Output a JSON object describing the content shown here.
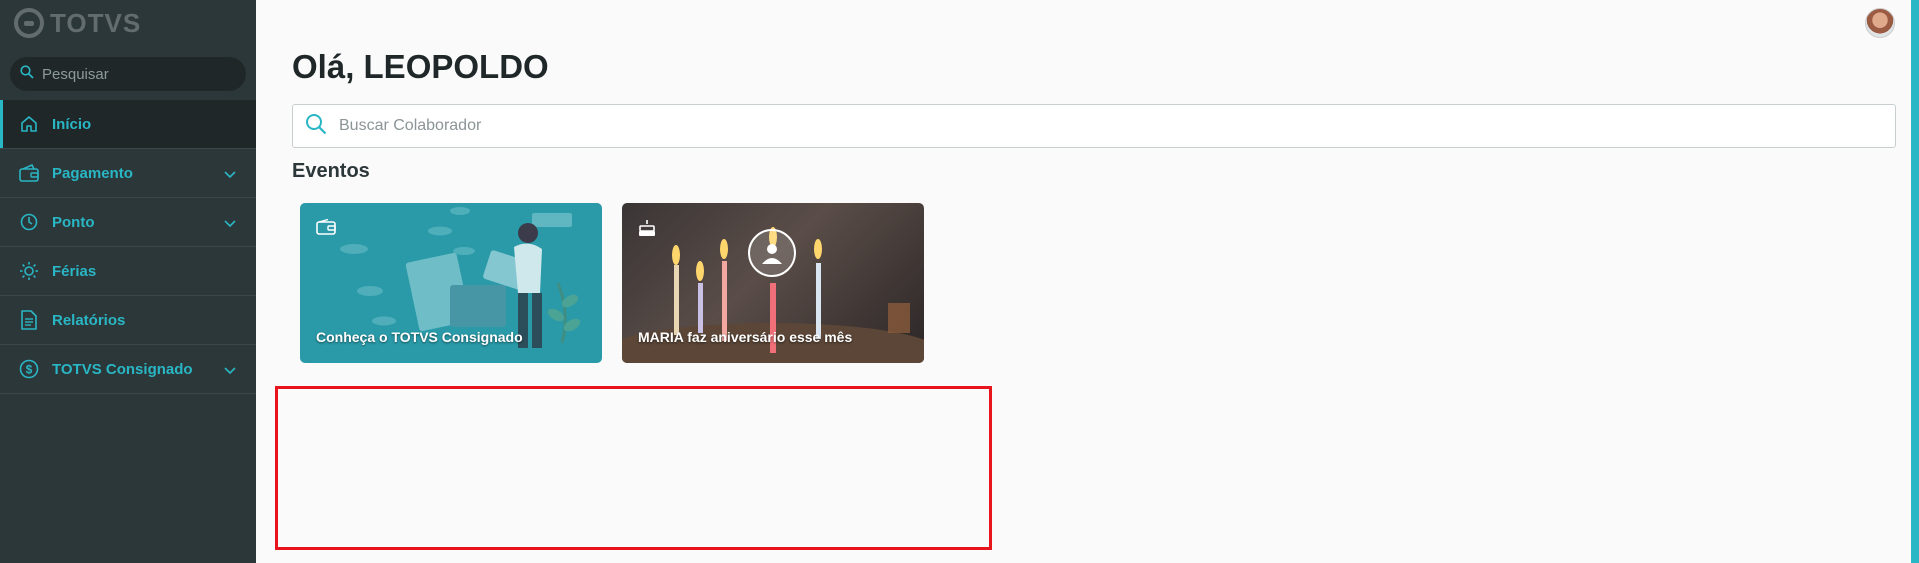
{
  "app": {
    "logo_text": "TOTVS"
  },
  "sidebar": {
    "search_placeholder": "Pesquisar",
    "items": [
      {
        "label": "Início",
        "icon": "home-icon",
        "active": true,
        "expandable": false
      },
      {
        "label": "Pagamento",
        "icon": "wallet-icon",
        "active": false,
        "expandable": true
      },
      {
        "label": "Ponto",
        "icon": "clock-icon",
        "active": false,
        "expandable": true
      },
      {
        "label": "Férias",
        "icon": "sun-icon",
        "active": false,
        "expandable": false
      },
      {
        "label": "Relatórios",
        "icon": "document-icon",
        "active": false,
        "expandable": false
      },
      {
        "label": "TOTVS Consignado",
        "icon": "dollar-circle-icon",
        "active": false,
        "expandable": true
      }
    ]
  },
  "main": {
    "greeting": "Olá, LEOPOLDO",
    "search_placeholder": "Buscar Colaborador",
    "events_title": "Eventos",
    "events": [
      {
        "caption": "Conheça o TOTVS Consignado",
        "icon": "wallet-icon"
      },
      {
        "caption": "MARIA faz aniversário esse mês",
        "icon": "cake-icon"
      }
    ]
  },
  "colors": {
    "sidebar_bg": "#2c3739",
    "accent": "#29b6c5",
    "highlight_border": "#e8141c",
    "card_teal": "#2a9aa8"
  }
}
